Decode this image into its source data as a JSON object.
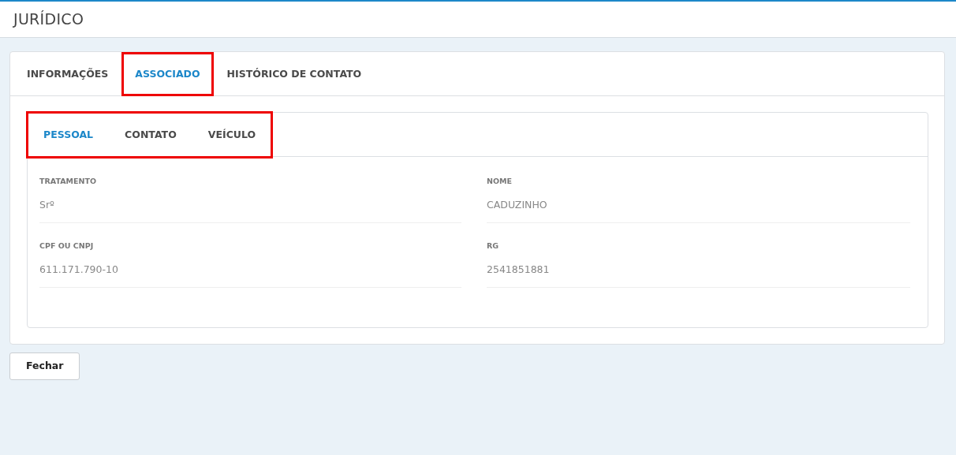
{
  "header": {
    "title": "JURÍDICO"
  },
  "tabs": [
    {
      "label": "INFORMAÇÕES",
      "selected": false,
      "highlighted": false
    },
    {
      "label": "ASSOCIADO",
      "selected": true,
      "highlighted": true
    },
    {
      "label": "HISTÓRICO DE CONTATO",
      "selected": false,
      "highlighted": false
    }
  ],
  "subtabs": {
    "highlighted": true,
    "items": [
      {
        "label": "PESSOAL",
        "selected": true
      },
      {
        "label": "CONTATO",
        "selected": false
      },
      {
        "label": "VEÍCULO",
        "selected": false
      }
    ]
  },
  "fields": [
    {
      "label": "TRATAMENTO",
      "value": "Srº"
    },
    {
      "label": "NOME",
      "value": "CADUZINHO"
    },
    {
      "label": "CPF OU CNPJ",
      "value": "611.171.790-10"
    },
    {
      "label": "RG",
      "value": "2541851881"
    }
  ],
  "buttons": [
    {
      "label": "Fechar"
    }
  ]
}
